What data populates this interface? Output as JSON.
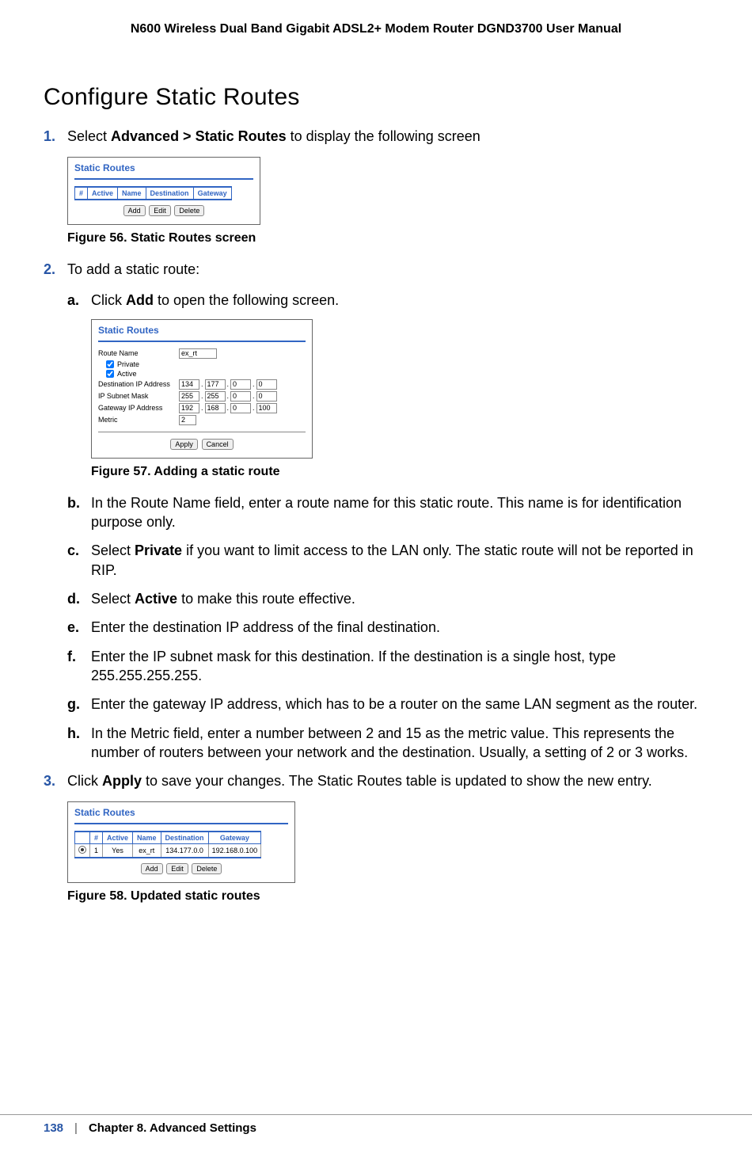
{
  "header": "N600 Wireless Dual Band Gigabit ADSL2+ Modem Router DGND3700 User Manual",
  "heading": "Configure Static Routes",
  "steps": {
    "s1": {
      "num": "1.",
      "pre": "Select ",
      "bold": "Advanced > Static Routes",
      "post": " to display the following screen"
    },
    "s2": {
      "num": "2.",
      "text": "To add a static route:"
    },
    "s3": {
      "num": "3.",
      "pre": "Click ",
      "bold": "Apply",
      "post": " to save your changes. The Static Routes table is updated to show the new entry."
    }
  },
  "substeps": {
    "a": {
      "num": "a.",
      "pre": "Click ",
      "bold": "Add",
      "post": " to open the following screen."
    },
    "b": {
      "num": "b.",
      "text": "In the Route Name field, enter a route name for this static route. This name is for identification purpose only."
    },
    "c": {
      "num": "c.",
      "pre": "Select ",
      "bold": "Private",
      "post": " if you want to limit access to the LAN only. The static route will not be reported in RIP."
    },
    "d": {
      "num": "d.",
      "pre": "Select ",
      "bold": "Active",
      "post": " to make this route effective."
    },
    "e": {
      "num": "e.",
      "text": "Enter the destination IP address of the final destination."
    },
    "f": {
      "num": "f.",
      "text": "Enter the IP subnet mask for this destination. If the destination is a single host, type 255.255.255.255."
    },
    "g": {
      "num": "g.",
      "text": "Enter the gateway IP address, which has to be a router on the same LAN segment as the router."
    },
    "h": {
      "num": "h.",
      "text": "In the Metric field, enter a number between 2 and 15 as the metric value. This represents the number of routers between your network and the destination. Usually, a setting of 2 or 3 works."
    }
  },
  "figures": {
    "f56": "Figure 56.  Static Routes screen",
    "f57": "Figure 57.  Adding a static route",
    "f58": "Figure 58.  Updated static routes"
  },
  "ss": {
    "title": "Static Routes",
    "cols": {
      "num": "#",
      "active": "Active",
      "name": "Name",
      "dest": "Destination",
      "gw": "Gateway"
    },
    "btns": {
      "add": "Add",
      "edit": "Edit",
      "del": "Delete",
      "apply": "Apply",
      "cancel": "Cancel"
    },
    "form": {
      "route_name_label": "Route Name",
      "route_name_val": "ex_rt",
      "private": "Private",
      "active": "Active",
      "dest_label": "Destination IP Address",
      "dest": [
        "134",
        "177",
        "0",
        "0"
      ],
      "mask_label": "IP Subnet Mask",
      "mask": [
        "255",
        "255",
        "0",
        "0"
      ],
      "gw_label": "Gateway IP Address",
      "gw": [
        "192",
        "168",
        "0",
        "100"
      ],
      "metric_label": "Metric",
      "metric_val": "2"
    },
    "row": {
      "num": "1",
      "active": "Yes",
      "name": "ex_rt",
      "dest": "134.177.0.0",
      "gw": "192.168.0.100"
    }
  },
  "footer": {
    "page": "138",
    "sep": "|",
    "chapter": "Chapter 8.  Advanced Settings"
  }
}
